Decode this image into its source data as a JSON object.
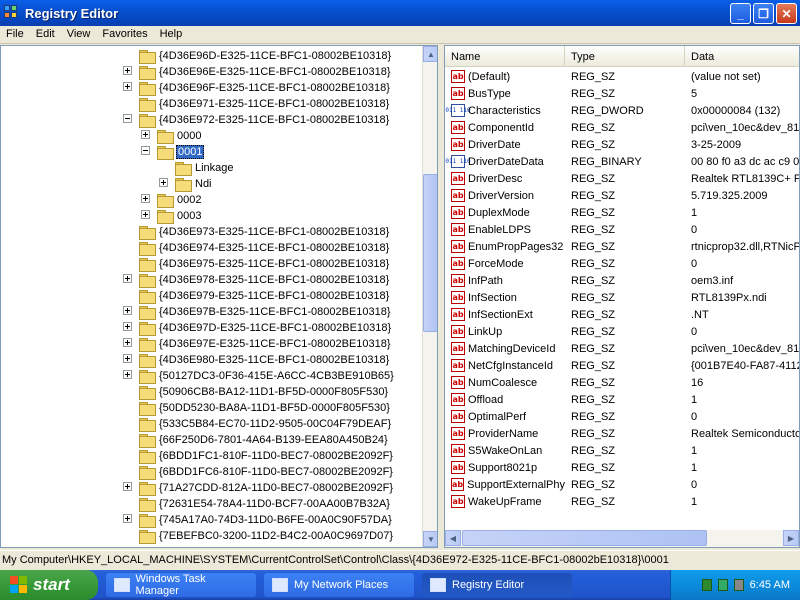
{
  "window": {
    "title": "Registry Editor"
  },
  "menu": [
    "File",
    "Edit",
    "View",
    "Favorites",
    "Help"
  ],
  "tree": [
    {
      "label": "{4D36E96D-E325-11CE-BFC1-08002BE10318}",
      "indent": 0,
      "exp": "none"
    },
    {
      "label": "{4D36E96E-E325-11CE-BFC1-08002BE10318}",
      "indent": 0,
      "exp": "plus"
    },
    {
      "label": "{4D36E96F-E325-11CE-BFC1-08002BE10318}",
      "indent": 0,
      "exp": "plus"
    },
    {
      "label": "{4D36E971-E325-11CE-BFC1-08002BE10318}",
      "indent": 0,
      "exp": "none"
    },
    {
      "label": "{4D36E972-E325-11CE-BFC1-08002BE10318}",
      "indent": 0,
      "exp": "minus"
    },
    {
      "label": "0000",
      "indent": 1,
      "exp": "plus"
    },
    {
      "label": "0001",
      "indent": 1,
      "exp": "minus",
      "selected": true
    },
    {
      "label": "Linkage",
      "indent": 2,
      "exp": "none"
    },
    {
      "label": "Ndi",
      "indent": 2,
      "exp": "plus"
    },
    {
      "label": "0002",
      "indent": 1,
      "exp": "plus"
    },
    {
      "label": "0003",
      "indent": 1,
      "exp": "plus"
    },
    {
      "label": "{4D36E973-E325-11CE-BFC1-08002BE10318}",
      "indent": 0,
      "exp": "none"
    },
    {
      "label": "{4D36E974-E325-11CE-BFC1-08002BE10318}",
      "indent": 0,
      "exp": "none"
    },
    {
      "label": "{4D36E975-E325-11CE-BFC1-08002BE10318}",
      "indent": 0,
      "exp": "none"
    },
    {
      "label": "{4D36E978-E325-11CE-BFC1-08002BE10318}",
      "indent": 0,
      "exp": "plus"
    },
    {
      "label": "{4D36E979-E325-11CE-BFC1-08002BE10318}",
      "indent": 0,
      "exp": "none"
    },
    {
      "label": "{4D36E97B-E325-11CE-BFC1-08002BE10318}",
      "indent": 0,
      "exp": "plus"
    },
    {
      "label": "{4D36E97D-E325-11CE-BFC1-08002BE10318}",
      "indent": 0,
      "exp": "plus"
    },
    {
      "label": "{4D36E97E-E325-11CE-BFC1-08002BE10318}",
      "indent": 0,
      "exp": "plus"
    },
    {
      "label": "{4D36E980-E325-11CE-BFC1-08002BE10318}",
      "indent": 0,
      "exp": "plus"
    },
    {
      "label": "{50127DC3-0F36-415E-A6CC-4CB3BE910B65}",
      "indent": 0,
      "exp": "plus"
    },
    {
      "label": "{50906CB8-BA12-11D1-BF5D-0000F805F530}",
      "indent": 0,
      "exp": "none"
    },
    {
      "label": "{50DD5230-BA8A-11D1-BF5D-0000F805F530}",
      "indent": 0,
      "exp": "none"
    },
    {
      "label": "{533C5B84-EC70-11D2-9505-00C04F79DEAF}",
      "indent": 0,
      "exp": "none"
    },
    {
      "label": "{66F250D6-7801-4A64-B139-EEA80A450B24}",
      "indent": 0,
      "exp": "none"
    },
    {
      "label": "{6BDD1FC1-810F-11D0-BEC7-08002BE2092F}",
      "indent": 0,
      "exp": "none"
    },
    {
      "label": "{6BDD1FC6-810F-11D0-BEC7-08002BE2092F}",
      "indent": 0,
      "exp": "none"
    },
    {
      "label": "{71A27CDD-812A-11D0-BEC7-08002BE2092F}",
      "indent": 0,
      "exp": "plus"
    },
    {
      "label": "{72631E54-78A4-11D0-BCF7-00AA00B7B32A}",
      "indent": 0,
      "exp": "none"
    },
    {
      "label": "{745A17A0-74D3-11D0-B6FE-00A0C90F57DA}",
      "indent": 0,
      "exp": "plus"
    },
    {
      "label": "{7EBEFBC0-3200-11D2-B4C2-00A0C9697D07}",
      "indent": 0,
      "exp": "none"
    }
  ],
  "list": {
    "headers": {
      "name": "Name",
      "type": "Type",
      "data": "Data"
    },
    "rows": [
      {
        "name": "(Default)",
        "type": "REG_SZ",
        "data": "(value not set)",
        "icon": "ab"
      },
      {
        "name": "BusType",
        "type": "REG_SZ",
        "data": "5",
        "icon": "ab"
      },
      {
        "name": "Characteristics",
        "type": "REG_DWORD",
        "data": "0x00000084 (132)",
        "icon": "bin"
      },
      {
        "name": "ComponentId",
        "type": "REG_SZ",
        "data": "pci\\ven_10ec&dev_81",
        "icon": "ab"
      },
      {
        "name": "DriverDate",
        "type": "REG_SZ",
        "data": "3-25-2009",
        "icon": "ab"
      },
      {
        "name": "DriverDateData",
        "type": "REG_BINARY",
        "data": "00 80 f0 a3 dc ac c9 0",
        "icon": "bin"
      },
      {
        "name": "DriverDesc",
        "type": "REG_SZ",
        "data": "Realtek RTL8139C+ Fa",
        "icon": "ab"
      },
      {
        "name": "DriverVersion",
        "type": "REG_SZ",
        "data": "5.719.325.2009",
        "icon": "ab"
      },
      {
        "name": "DuplexMode",
        "type": "REG_SZ",
        "data": "1",
        "icon": "ab"
      },
      {
        "name": "EnableLDPS",
        "type": "REG_SZ",
        "data": "0",
        "icon": "ab"
      },
      {
        "name": "EnumPropPages32",
        "type": "REG_SZ",
        "data": "rtnicprop32.dll,RTNicPr",
        "icon": "ab"
      },
      {
        "name": "ForceMode",
        "type": "REG_SZ",
        "data": "0",
        "icon": "ab"
      },
      {
        "name": "InfPath",
        "type": "REG_SZ",
        "data": "oem3.inf",
        "icon": "ab"
      },
      {
        "name": "InfSection",
        "type": "REG_SZ",
        "data": "RTL8139Px.ndi",
        "icon": "ab"
      },
      {
        "name": "InfSectionExt",
        "type": "REG_SZ",
        "data": ".NT",
        "icon": "ab"
      },
      {
        "name": "LinkUp",
        "type": "REG_SZ",
        "data": "0",
        "icon": "ab"
      },
      {
        "name": "MatchingDeviceId",
        "type": "REG_SZ",
        "data": "pci\\ven_10ec&dev_81",
        "icon": "ab"
      },
      {
        "name": "NetCfgInstanceId",
        "type": "REG_SZ",
        "data": "{001B7E40-FA87-4112",
        "icon": "ab"
      },
      {
        "name": "NumCoalesce",
        "type": "REG_SZ",
        "data": "16",
        "icon": "ab"
      },
      {
        "name": "Offload",
        "type": "REG_SZ",
        "data": "1",
        "icon": "ab"
      },
      {
        "name": "OptimalPerf",
        "type": "REG_SZ",
        "data": "0",
        "icon": "ab"
      },
      {
        "name": "ProviderName",
        "type": "REG_SZ",
        "data": "Realtek Semiconductor",
        "icon": "ab"
      },
      {
        "name": "S5WakeOnLan",
        "type": "REG_SZ",
        "data": "1",
        "icon": "ab"
      },
      {
        "name": "Support8021p",
        "type": "REG_SZ",
        "data": "1",
        "icon": "ab"
      },
      {
        "name": "SupportExternalPhy",
        "type": "REG_SZ",
        "data": "0",
        "icon": "ab"
      },
      {
        "name": "WakeUpFrame",
        "type": "REG_SZ",
        "data": "1",
        "icon": "ab"
      }
    ]
  },
  "status": {
    "path": "My Computer\\HKEY_LOCAL_MACHINE\\SYSTEM\\CurrentControlSet\\Control\\Class\\{4D36E972-E325-11CE-BFC1-08002bE10318}\\0001"
  },
  "taskbar": {
    "start": "start",
    "buttons": [
      {
        "label": "Windows Task Manager",
        "active": false
      },
      {
        "label": "My Network Places",
        "active": false
      },
      {
        "label": "Registry Editor",
        "active": true
      }
    ],
    "clock": "6:45 AM"
  },
  "icons": {
    "tree": "folder-icon",
    "string_value": "string-value-icon",
    "binary_value": "binary-value-icon"
  }
}
